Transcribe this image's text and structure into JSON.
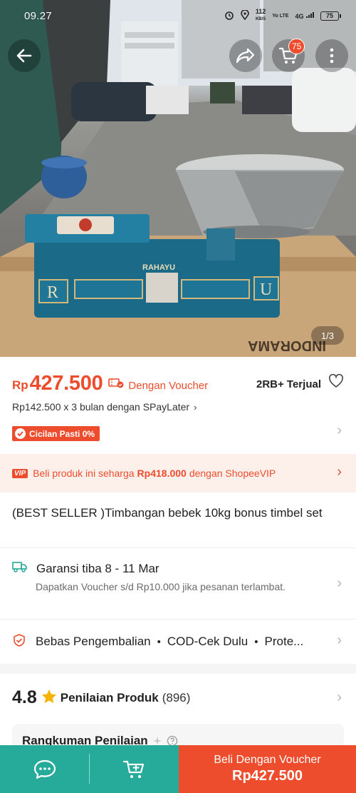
{
  "status_bar": {
    "time": "09.27",
    "network_speed": "112",
    "network_unit": "KB/S",
    "volte": "Yo LTE",
    "signal": "4G",
    "battery": "75"
  },
  "header": {
    "cart_count": "75",
    "image_counter": "1/3"
  },
  "price": {
    "currency": "Rp",
    "amount": "427.500",
    "voucher_label": "Dengan Voucher",
    "sold": "2RB+ Terjual",
    "paylater": "Rp142.500 x 3 bulan dengan SPayLater",
    "cicilan": "Cicilan Pasti 0%"
  },
  "vip": {
    "badge": "VIP",
    "prefix": "Beli produk ini seharga",
    "price": "Rp418.000",
    "suffix": "dengan ShopeeVIP"
  },
  "product": {
    "title": "(BEST SELLER )Timbangan bebek 10kg bonus timbel set"
  },
  "shipping": {
    "title": "Garansi tiba 8 - 11 Mar",
    "subtitle": "Dapatkan Voucher s/d Rp10.000 jika pesanan terlambat."
  },
  "guarantees": [
    "Bebas Pengembalian",
    "COD-Cek Dulu",
    "Prote..."
  ],
  "rating": {
    "value": "4.8",
    "label": "Penilaian Produk",
    "count": "(896)",
    "summary_title": "Rangkuman Penilaian"
  },
  "bottom_bar": {
    "buy_label": "Beli Dengan Voucher",
    "buy_price": "Rp427.500"
  },
  "colors": {
    "primary": "#ee4d2d",
    "chat_green": "#26aa99",
    "vip_bg": "#fdefea"
  },
  "icons": [
    "back-arrow-icon",
    "share-icon",
    "cart-icon",
    "more-icon",
    "voucher-icon",
    "heart-icon",
    "check-icon",
    "truck-icon",
    "shield-icon",
    "star-icon",
    "sparkle-icon",
    "help-icon",
    "chat-icon",
    "add-to-cart-icon"
  ]
}
